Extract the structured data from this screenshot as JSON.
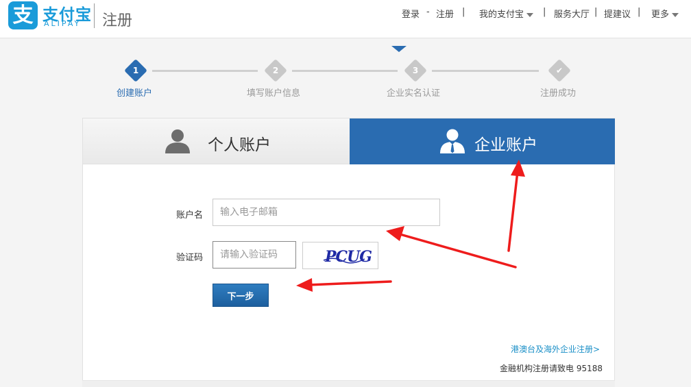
{
  "header": {
    "logo_icon": "支",
    "logo_cn": "支付宝",
    "logo_en": "ALIPAY",
    "page_title": "注册",
    "nav": {
      "login": "登录",
      "dash": "-",
      "register": "注册",
      "sep": "|",
      "my_alipay": "我的支付宝",
      "service_hall": "服务大厅",
      "suggestion": "提建议",
      "more": "更多"
    }
  },
  "steps": [
    {
      "num": "1",
      "label": "创建账户",
      "state": "active"
    },
    {
      "num": "2",
      "label": "填写账户信息",
      "state": "pending"
    },
    {
      "num": "3",
      "label": "企业实名认证",
      "state": "pending"
    },
    {
      "num": "✔",
      "label": "注册成功",
      "state": "pending"
    }
  ],
  "tabs": {
    "personal": "个人账户",
    "enterprise": "企业账户",
    "selected": "enterprise"
  },
  "form": {
    "account_label": "账户名",
    "account_placeholder": "输入电子邮箱",
    "account_value": "",
    "captcha_label": "验证码",
    "captcha_placeholder": "请输入验证码",
    "captcha_value": "",
    "captcha_text": "PCUG",
    "next_button": "下一步"
  },
  "footer": {
    "overseas_link": "港澳台及海外企业注册>",
    "contact_text": "金融机构注册请致电 95188"
  },
  "colors": {
    "brand": "#1a9bd9",
    "active_step": "#2a6cb1",
    "pending_step": "#c8c8c8",
    "enterprise_tab": "#2a6cb1",
    "annotation_arrow": "#ee1c1c"
  },
  "icons": {
    "logo": "alipay-logo-icon",
    "dropdown": "caret-down-icon",
    "personal": "person-icon",
    "enterprise": "business-person-icon"
  }
}
